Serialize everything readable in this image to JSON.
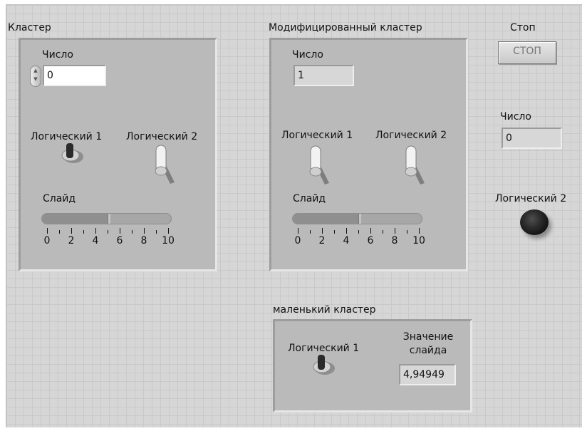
{
  "cluster": {
    "title": "Кластер",
    "number": {
      "label": "Число",
      "value": "0"
    },
    "bool1": {
      "label": "Логический 1",
      "state": "on"
    },
    "bool2": {
      "label": "Логический 2",
      "state": "off"
    },
    "slide": {
      "label": "Слайд",
      "value": 4.94949,
      "min": 0,
      "max": 10,
      "ticks": [
        "0",
        "2",
        "4",
        "6",
        "8",
        "10"
      ]
    }
  },
  "modified_cluster": {
    "title": "Модифицированный кластер",
    "number": {
      "label": "Число",
      "value": "1"
    },
    "bool1": {
      "label": "Логический 1",
      "state": "off"
    },
    "bool2": {
      "label": "Логический 2",
      "state": "off"
    },
    "slide": {
      "label": "Слайд",
      "value": 4.94949,
      "min": 0,
      "max": 10,
      "ticks": [
        "0",
        "2",
        "4",
        "6",
        "8",
        "10"
      ]
    }
  },
  "stop": {
    "label": "Стоп",
    "button_text": "СТОП"
  },
  "number_indicator": {
    "label": "Число",
    "value": "0"
  },
  "bool2_led": {
    "label": "Логический 2",
    "state": "off"
  },
  "small_cluster": {
    "title": "маленький кластер",
    "bool1": {
      "label": "Логический 1",
      "state": "on"
    },
    "slide_value": {
      "label_line1": "Значение",
      "label_line2": "слайда",
      "value": "4,94949"
    }
  },
  "colors": {
    "panel_bg": "#d6d6d6",
    "cluster_bg": "#bababa",
    "led_off": "#2a2a2a"
  }
}
